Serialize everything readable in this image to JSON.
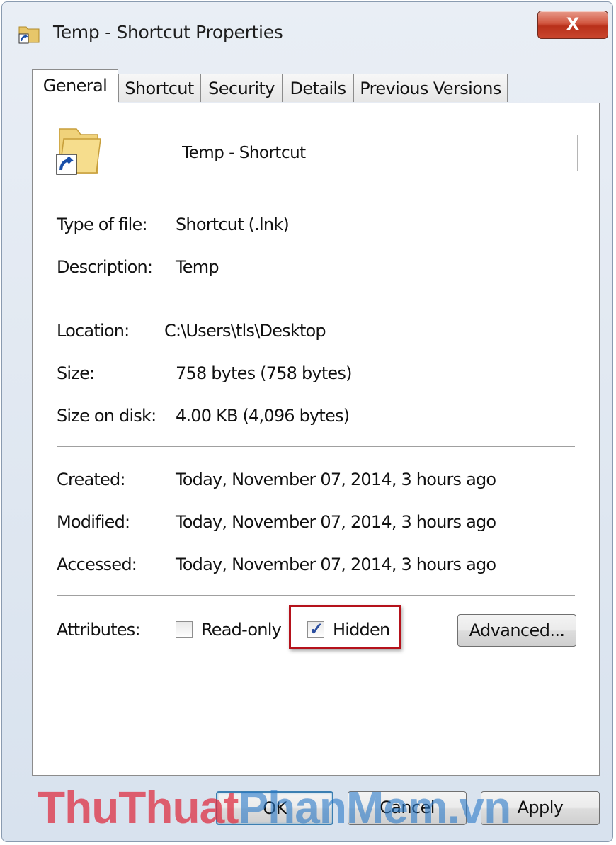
{
  "window": {
    "title": "Temp - Shortcut Properties",
    "close_label": "X"
  },
  "tabs": [
    {
      "label": "General",
      "active": true
    },
    {
      "label": "Shortcut",
      "active": false
    },
    {
      "label": "Security",
      "active": false
    },
    {
      "label": "Details",
      "active": false
    },
    {
      "label": "Previous Versions",
      "active": false
    }
  ],
  "general": {
    "name_value": "Temp - Shortcut",
    "type_label": "Type of file:",
    "type_value": "Shortcut (.lnk)",
    "description_label": "Description:",
    "description_value": "Temp",
    "location_label": "Location:",
    "location_value": "C:\\Users\\tls\\Desktop",
    "size_label": "Size:",
    "size_value": "758 bytes (758 bytes)",
    "size_on_disk_label": "Size on disk:",
    "size_on_disk_value": "4.00 KB (4,096 bytes)",
    "created_label": "Created:",
    "created_value": "Today, November 07, 2014, 3 hours ago",
    "modified_label": "Modified:",
    "modified_value": "Today, November 07, 2014, 3 hours ago",
    "accessed_label": "Accessed:",
    "accessed_value": "Today, November 07, 2014, 3 hours ago",
    "attributes_label": "Attributes:",
    "readonly_label": "Read-only",
    "readonly_checked": false,
    "hidden_label": "Hidden",
    "hidden_checked": true,
    "advanced_label": "Advanced..."
  },
  "footer": {
    "ok_label": "OK",
    "cancel_label": "Cancel",
    "apply_label": "Apply"
  },
  "watermark": {
    "part1": "ThuThuat",
    "part2": "PhanMem.vn"
  },
  "colors": {
    "highlight_border": "#b5121b",
    "close_button": "#c9462e",
    "check_mark": "#2b4e9f"
  },
  "icons": {
    "title": "shortcut-folder-icon",
    "main": "folder-shortcut-icon"
  }
}
